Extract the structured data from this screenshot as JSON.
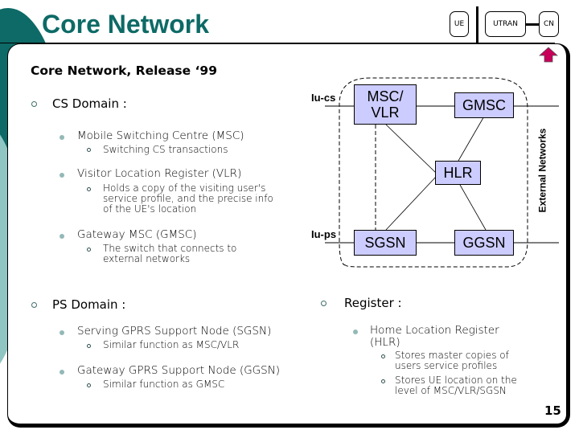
{
  "slide": {
    "title": "Core Network",
    "subtitle": "Core Network, Release ‘99",
    "page_number": "15",
    "accent_color": "#0d6a66",
    "arrow_color": "#c8005a"
  },
  "nav": {
    "items": [
      {
        "label": "UE"
      },
      {
        "label": "UTRAN"
      },
      {
        "label": "CN"
      }
    ],
    "up_arrow_icon": "up-arrow-icon"
  },
  "left": {
    "cs": {
      "heading": "CS Domain :",
      "items": [
        {
          "label": "Mobile Switching Centre (MSC)",
          "sub": [
            "Switching CS transactions"
          ]
        },
        {
          "label": "Visitor Location Register (VLR)",
          "sub": [
            "Holds a copy of the visiting user's",
            "service profile, and the precise info",
            "of the UE's location"
          ]
        },
        {
          "label": "Gateway MSC (GMSC)",
          "sub": [
            "The switch that connects to",
            "external networks"
          ]
        }
      ]
    },
    "ps": {
      "heading": "PS Domain :",
      "items": [
        {
          "label": "Serving GPRS Support Node (SGSN)",
          "sub": [
            "Similar function as MSC/VLR"
          ]
        },
        {
          "label": "Gateway GPRS Support Node (GGSN)",
          "sub": [
            "Similar function as GMSC"
          ]
        }
      ]
    }
  },
  "register": {
    "heading": "Register :",
    "item": {
      "label_line1": "Home Location Register",
      "label_line2": "(HLR)"
    },
    "sub": [
      [
        "Stores master copies of",
        "users service profiles"
      ],
      [
        "Stores UE location on the",
        "level of MSC/VLR/SGSN"
      ]
    ]
  },
  "diagram": {
    "nodes": {
      "msc_vlr_line1": "MSC/",
      "msc_vlr_line2": "VLR",
      "gmsc": "GMSC",
      "hlr": "HLR",
      "sgsn": "SGSN",
      "ggsn": "GGSN"
    },
    "interfaces": {
      "iu_cs": "Iu-cs",
      "iu_ps": "Iu-ps"
    },
    "external_label": "External Networks",
    "node_fill": "#ccccff"
  }
}
